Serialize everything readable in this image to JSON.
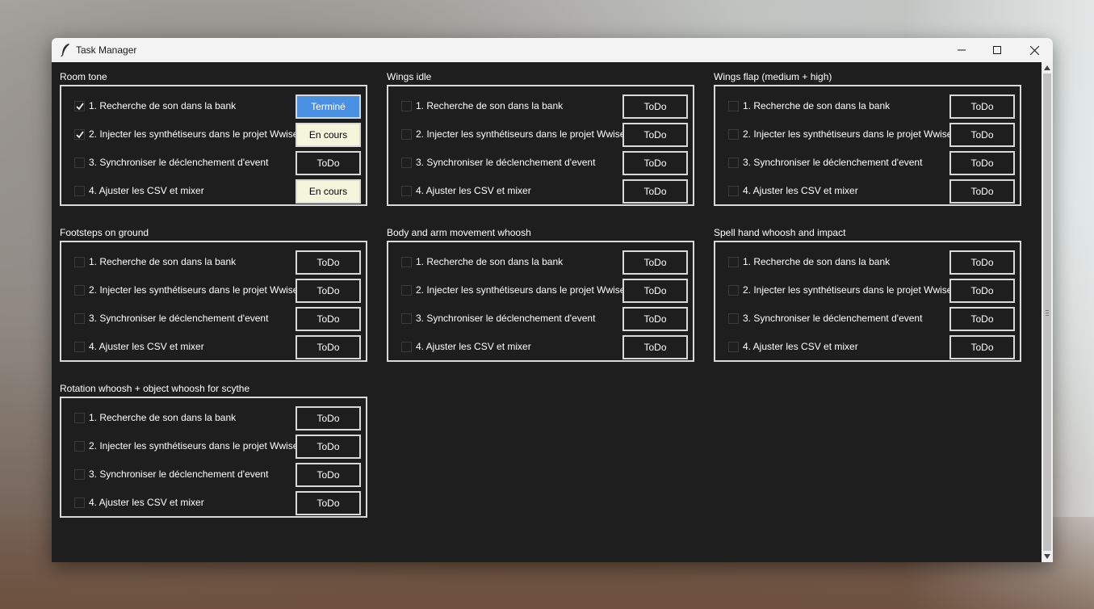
{
  "window": {
    "title": "Task Manager"
  },
  "colors": {
    "done": "#4a90e2",
    "in_progress": "#f5f5dc",
    "todo": "#1e1e1e",
    "background": "#1e1e1e"
  },
  "groups": [
    {
      "title": "Room tone",
      "tasks": [
        {
          "label": "1. Recherche de son dans la bank",
          "checked": true,
          "status": "Terminé",
          "state": "done"
        },
        {
          "label": "2. Injecter les synthétiseurs dans le projet Wwise",
          "checked": true,
          "status": "En cours",
          "state": "inprogress"
        },
        {
          "label": "3. Synchroniser le déclenchement d'event",
          "checked": false,
          "status": "ToDo",
          "state": "todo"
        },
        {
          "label": "4. Ajuster les CSV et mixer",
          "checked": false,
          "status": "En cours",
          "state": "inprogress"
        }
      ]
    },
    {
      "title": "Wings idle",
      "tasks": [
        {
          "label": "1. Recherche de son dans la bank",
          "checked": false,
          "status": "ToDo",
          "state": "todo"
        },
        {
          "label": "2. Injecter les synthétiseurs dans le projet Wwise",
          "checked": false,
          "status": "ToDo",
          "state": "todo"
        },
        {
          "label": "3. Synchroniser le déclenchement d'event",
          "checked": false,
          "status": "ToDo",
          "state": "todo"
        },
        {
          "label": "4. Ajuster les CSV et mixer",
          "checked": false,
          "status": "ToDo",
          "state": "todo"
        }
      ]
    },
    {
      "title": "Wings flap (medium + high)",
      "tasks": [
        {
          "label": "1. Recherche de son dans la bank",
          "checked": false,
          "status": "ToDo",
          "state": "todo"
        },
        {
          "label": "2. Injecter les synthétiseurs dans le projet Wwise",
          "checked": false,
          "status": "ToDo",
          "state": "todo"
        },
        {
          "label": "3. Synchroniser le déclenchement d'event",
          "checked": false,
          "status": "ToDo",
          "state": "todo"
        },
        {
          "label": "4. Ajuster les CSV et mixer",
          "checked": false,
          "status": "ToDo",
          "state": "todo"
        }
      ]
    },
    {
      "title": "Footsteps on ground",
      "tasks": [
        {
          "label": "1. Recherche de son dans la bank",
          "checked": false,
          "status": "ToDo",
          "state": "todo"
        },
        {
          "label": "2. Injecter les synthétiseurs dans le projet Wwise",
          "checked": false,
          "status": "ToDo",
          "state": "todo"
        },
        {
          "label": "3. Synchroniser le déclenchement d'event",
          "checked": false,
          "status": "ToDo",
          "state": "todo"
        },
        {
          "label": "4. Ajuster les CSV et mixer",
          "checked": false,
          "status": "ToDo",
          "state": "todo"
        }
      ]
    },
    {
      "title": "Body and arm movement whoosh",
      "tasks": [
        {
          "label": "1. Recherche de son dans la bank",
          "checked": false,
          "status": "ToDo",
          "state": "todo"
        },
        {
          "label": "2. Injecter les synthétiseurs dans le projet Wwise",
          "checked": false,
          "status": "ToDo",
          "state": "todo"
        },
        {
          "label": "3. Synchroniser le déclenchement d'event",
          "checked": false,
          "status": "ToDo",
          "state": "todo"
        },
        {
          "label": "4. Ajuster les CSV et mixer",
          "checked": false,
          "status": "ToDo",
          "state": "todo"
        }
      ]
    },
    {
      "title": "Spell hand whoosh and impact",
      "tasks": [
        {
          "label": "1. Recherche de son dans la bank",
          "checked": false,
          "status": "ToDo",
          "state": "todo"
        },
        {
          "label": "2. Injecter les synthétiseurs dans le projet Wwise",
          "checked": false,
          "status": "ToDo",
          "state": "todo"
        },
        {
          "label": "3. Synchroniser le déclenchement d'event",
          "checked": false,
          "status": "ToDo",
          "state": "todo"
        },
        {
          "label": "4. Ajuster les CSV et mixer",
          "checked": false,
          "status": "ToDo",
          "state": "todo"
        }
      ]
    },
    {
      "title": "Rotation whoosh + object whoosh for scythe",
      "tasks": [
        {
          "label": "1. Recherche de son dans la bank",
          "checked": false,
          "status": "ToDo",
          "state": "todo"
        },
        {
          "label": "2. Injecter les synthétiseurs dans le projet Wwise",
          "checked": false,
          "status": "ToDo",
          "state": "todo"
        },
        {
          "label": "3. Synchroniser le déclenchement d'event",
          "checked": false,
          "status": "ToDo",
          "state": "todo"
        },
        {
          "label": "4. Ajuster les CSV et mixer",
          "checked": false,
          "status": "ToDo",
          "state": "todo"
        }
      ]
    }
  ]
}
